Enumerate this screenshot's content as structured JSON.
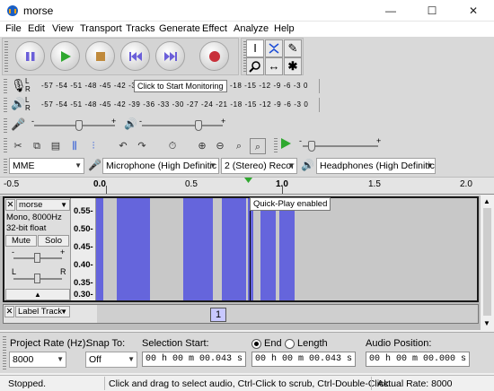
{
  "window": {
    "title": "morse",
    "minimize": "—",
    "maximize": "☐",
    "close": "✕"
  },
  "menu": [
    "File",
    "Edit",
    "View",
    "Transport",
    "Tracks",
    "Generate",
    "Effect",
    "Analyze",
    "Help"
  ],
  "meters": {
    "record_ticks": "-57 -54 -51 -48 -45 -42 -3",
    "record_tooltip": "Click to Start Monitoring",
    "record_ticks_right": "-18 -15 -12 -9 -6 -3 0",
    "play_ticks": "-57 -54 -51 -48 -45 -42 -39 -36 -33 -30 -27 -24 -21 -18 -15 -12 -9 -6 -3 0",
    "lr_top": "L",
    "lr_bottom": "R"
  },
  "devices": {
    "host": "MME",
    "recording_device": "Microphone (High Definitic",
    "channels": "2 (Stereo) Recor",
    "playback_device": "Headphones (High Definitic"
  },
  "ruler": {
    "labels": [
      "-0.5",
      "0.0",
      "0.5",
      "1.0",
      "1.5",
      "2.0"
    ],
    "tooltip": "Quick-Play enabled"
  },
  "track": {
    "name": "morse",
    "info1": "Mono, 8000Hz",
    "info2": "32-bit float",
    "mute": "Mute",
    "solo": "Solo",
    "gain_minus": "-",
    "gain_plus": "+",
    "pan_left": "L",
    "pan_right": "R",
    "close": "✕",
    "dropdown": "▼",
    "scale": [
      "0.55-",
      "0.50-",
      "0.45-",
      "0.40-",
      "0.35-",
      "0.30-"
    ],
    "collapse": "▲"
  },
  "label_track": {
    "name": "Label Track",
    "label_text": "1",
    "close": "✕",
    "dropdown": "▼"
  },
  "selection_toolbar": {
    "project_rate_label": "Project Rate (Hz):",
    "project_rate": "8000",
    "snap_label": "Snap To:",
    "snap_value": "Off",
    "sel_start_label": "Selection Start:",
    "sel_start": "00 h 00 m 00.043 s",
    "end_label": "End",
    "length_label": "Length",
    "sel_end": "00 h 00 m 00.043 s",
    "audio_pos_label": "Audio Position:",
    "audio_pos": "00 h 00 m 00.000 s"
  },
  "status": {
    "state": "Stopped.",
    "hint": "Click and drag to select audio, Ctrl-Click to scrub, Ctrl-Double-Click...",
    "rate": "Actual Rate: 8000"
  },
  "colors": {
    "waveform_blue": "#6565dc",
    "play_green": "#2fa82f",
    "record_red": "#c8303a",
    "transport_purple": "#6b5fd9"
  },
  "chart_data": {
    "type": "table",
    "waveform_blocks": [
      {
        "start": -0.01,
        "end": 0.04
      },
      {
        "start": 0.11,
        "end": 0.29
      },
      {
        "start": 0.47,
        "end": 0.63
      },
      {
        "start": 0.68,
        "end": 0.81
      },
      {
        "start": 0.82,
        "end": 0.85
      },
      {
        "start": 0.89,
        "end": 0.94
      },
      {
        "start": 0.94,
        "end": 0.97
      },
      {
        "start": 0.99,
        "end": 1.07
      }
    ],
    "xlim": [
      -0.52,
      2.15
    ]
  }
}
